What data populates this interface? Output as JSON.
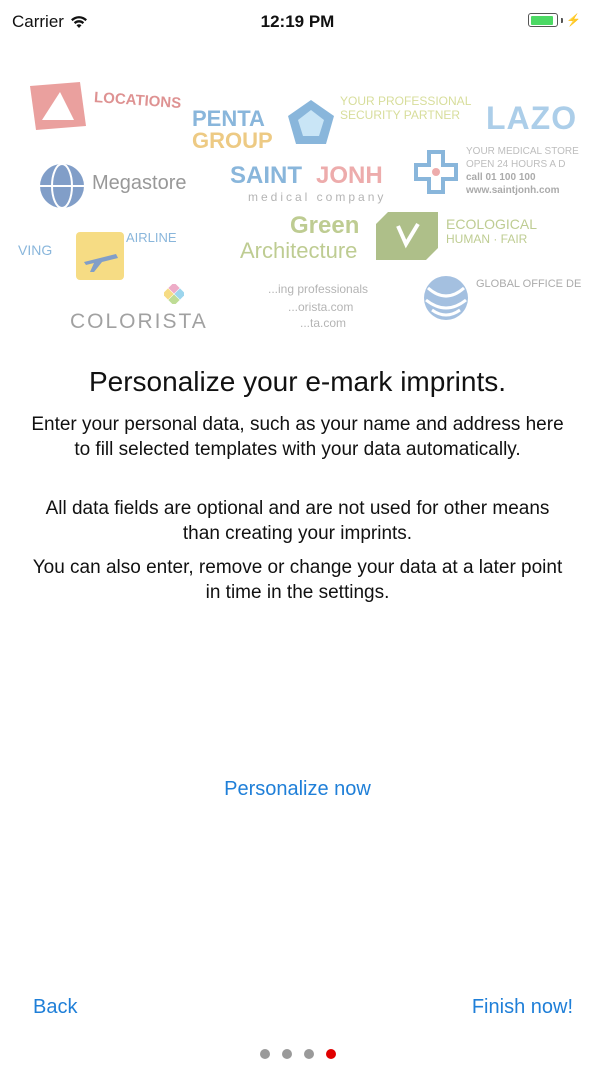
{
  "status_bar": {
    "carrier": "Carrier",
    "time": "12:19 PM"
  },
  "collage": {
    "locations": "LOCATIONS",
    "penta_1": "PENTA",
    "penta_2": "GROUP",
    "your_professional": "YOUR PROFESSIONAL",
    "security_partner": "SECURITY PARTNER",
    "lazo": "LAZO",
    "megastore": "Megastore",
    "saint": "SAINT",
    "jonh": "JONH",
    "medical_company": "medical company",
    "medical_store": "YOUR MEDICAL STORE",
    "open_24": "OPEN 24 HOURS A D",
    "call": "call 01 100 100",
    "saint_url": "www.saintjonh.com",
    "green": "Green",
    "architecture": "Architecture",
    "ecological": "ECOLOGICAL",
    "human_fair": "HUMAN · FAIR",
    "ving": "VING",
    "airline": "AIRLINE",
    "colorista": "COLORISTA",
    "professionals": "...ing professionals",
    "orista": "...orista.com",
    "ta_com": "...ta.com",
    "global_office": "GLOBAL OFFICE DE"
  },
  "headline": "Personalize your e-mark imprints.",
  "paragraphs": [
    "Enter your personal data, such as your name and address here to fill selected templates with your data automatically.",
    "All data fields are optional and are not used for other means than creating your imprints.",
    "You can also enter, remove or change your data at a later point in time in the settings."
  ],
  "buttons": {
    "personalize": "Personalize now",
    "back": "Back",
    "finish": "Finish now!"
  },
  "pager": {
    "count": 4,
    "current": 4
  },
  "colors": {
    "accent": "#1f7fd8",
    "active_dot": "#e00000",
    "battery": "#4cd964"
  }
}
